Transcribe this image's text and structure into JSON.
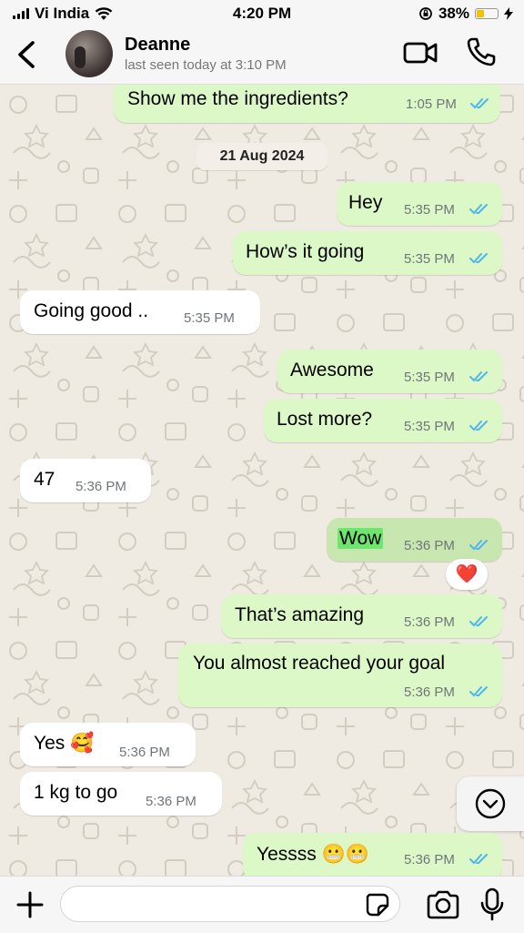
{
  "status_bar": {
    "carrier": "Vi India",
    "time": "4:20 PM",
    "battery": "38%",
    "battery_level": 0.38
  },
  "header": {
    "contact_name": "Deanne",
    "last_seen": "last seen today at 3:10 PM"
  },
  "date_divider": "21 Aug 2024",
  "messages": [
    {
      "text": "Show me the ingredients?",
      "time": "1:05 PM",
      "direction": "out"
    },
    {
      "text": "Hey",
      "time": "5:35 PM",
      "direction": "out"
    },
    {
      "text": "How’s it going",
      "time": "5:35 PM",
      "direction": "out"
    },
    {
      "text": "Going good ..",
      "time": "5:35 PM",
      "direction": "in"
    },
    {
      "text": "Awesome",
      "time": "5:35 PM",
      "direction": "out"
    },
    {
      "text": "Lost more?",
      "time": "5:35 PM",
      "direction": "out"
    },
    {
      "text": "47",
      "time": "5:36 PM",
      "direction": "in"
    },
    {
      "text": "Wow",
      "time": "5:36 PM",
      "direction": "out",
      "reaction": "❤️"
    },
    {
      "text": "That’s amazing",
      "time": "5:36 PM",
      "direction": "out"
    },
    {
      "text": "You almost reached your goal",
      "time": "5:36 PM",
      "direction": "out"
    },
    {
      "text": "Yes 🥰",
      "time": "5:36 PM",
      "direction": "in"
    },
    {
      "text": "1 kg to go",
      "time": "5:36 PM",
      "direction": "in"
    },
    {
      "text": "Yessss 😬😬",
      "time": "5:36 PM",
      "direction": "out"
    }
  ],
  "composer": {
    "input_value": "",
    "placeholder": ""
  },
  "colors": {
    "outgoing_bubble": "#dcf8c6",
    "incoming_bubble": "#ffffff",
    "chat_background": "#efeae2",
    "read_ticks": "#4fb6ec",
    "battery_fill": "#f2c200"
  },
  "icons": {
    "back": "chevron-left-icon",
    "video": "video-camera-icon",
    "call": "phone-icon",
    "scroll": "chevron-down-icon",
    "plus": "plus-icon",
    "sticker": "sticker-icon",
    "camera": "camera-icon",
    "mic": "microphone-icon"
  }
}
